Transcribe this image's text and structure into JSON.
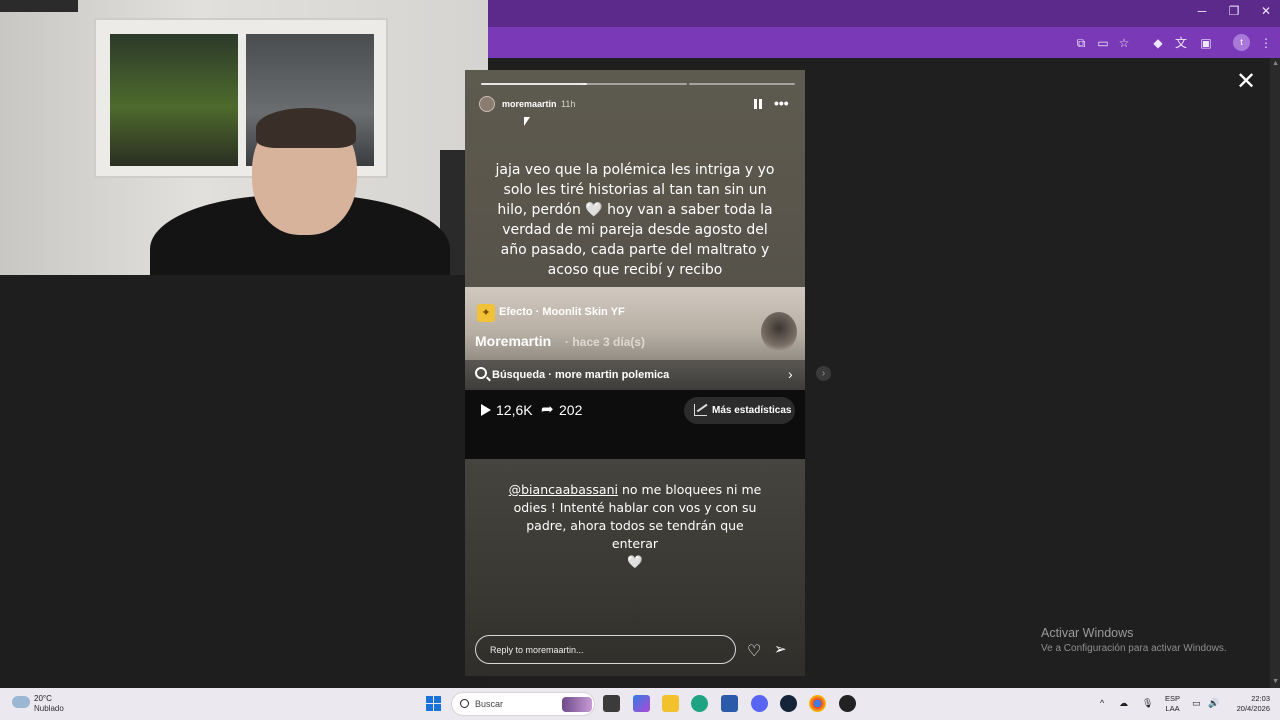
{
  "browser": {
    "window_controls": {
      "minimize": "─",
      "restore": "❐",
      "close": "✕"
    }
  },
  "story": {
    "username": "moremaartin",
    "time_ago": "11h",
    "caption": "jaja veo que la polémica les intriga y yo solo les tiré historias al tan tan sin un hilo, perdón 🤍 hoy van a saber toda la verdad de mi pareja desde agosto del año pasado, cada parte del maltrato y acoso que recibí y recibo",
    "reel": {
      "effect_label": "Efecto · Moonlit Skin YF",
      "author": "Moremartin",
      "posted": "· hace 3 día(s)",
      "search_label": "Búsqueda · more martin polemica",
      "plays": "12,6K",
      "shares": "202",
      "stats_button": "Más estadísticas"
    },
    "bottom_mention": "@biancaabassani",
    "bottom_text": " no me bloquees ni me odies ! Intenté hablar con vos y con su padre, ahora todos se tendrán que enterar",
    "bottom_heart": "🤍",
    "reply_placeholder": "Reply to moremaartin..."
  },
  "watermark": {
    "title": "Activar Windows",
    "subtitle": "Ve a Configuración para activar Windows."
  },
  "taskbar": {
    "weather_temp": "20°C",
    "weather_desc": "Nublado",
    "search_placeholder": "Buscar",
    "lang_top": "ESP",
    "lang_bottom": "LAA",
    "time": "22:03",
    "date": "20/4/2026"
  },
  "colors": {
    "chrome_accent": "#7a3ab7",
    "chrome_top": "#5b2a8a",
    "taskbar": "#ebe8f0"
  }
}
